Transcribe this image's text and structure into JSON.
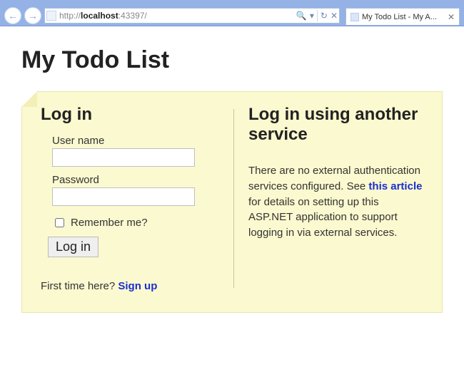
{
  "browser": {
    "url_prefix": "http://",
    "url_host": "localhost",
    "url_port": ":43397/",
    "tab_title": "My Todo List - My A..."
  },
  "page": {
    "title": "My Todo List"
  },
  "login": {
    "heading": "Log in",
    "username_label": "User name",
    "username_value": "",
    "password_label": "Password",
    "password_value": "",
    "remember_label": "Remember me?",
    "submit_label": "Log in",
    "first_time_text": "First time here? ",
    "signup_link": "Sign up"
  },
  "external": {
    "heading": "Log in using another service",
    "text_before": "There are no external authentication services configured. See ",
    "link_text": "this article",
    "text_after": " for details on setting up this ASP.NET application to support logging in via external services."
  }
}
